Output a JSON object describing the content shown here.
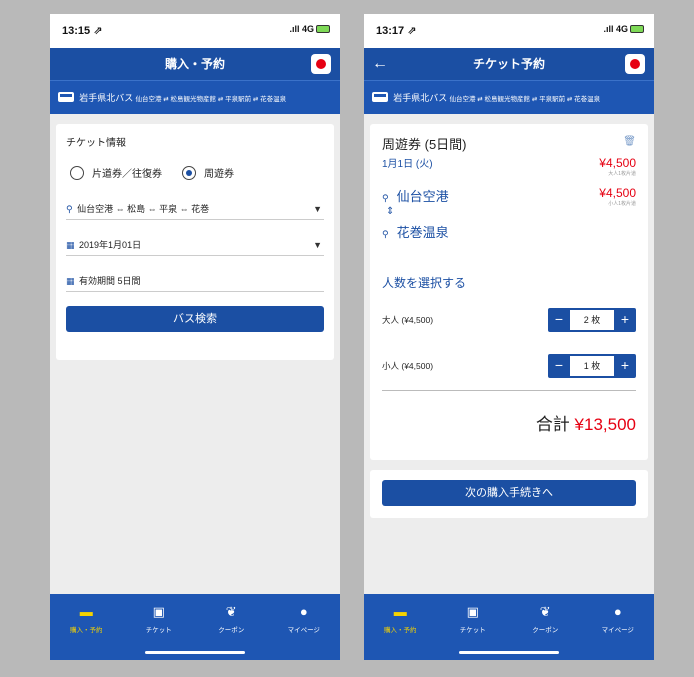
{
  "left": {
    "status_time": "13:15 ⇗",
    "status_signal": ".ıll 4G",
    "nav_title": "購入・予約",
    "route_label": "岩手県北バス",
    "route_stops": "仙台空港 ⇄ 松島観光物産館 ⇄ 平泉駅前 ⇄ 花巻温泉",
    "section_title": "チケット情報",
    "radio_oneway": "片道券／往復券",
    "radio_pass": "周遊券",
    "route_select": "仙台空港 ⇔ 松島 ⇔ 平泉 ⇔ 花巻",
    "date_select": "2019年1月01日",
    "validity": "有効期間 5日間",
    "search_button": "バス検索"
  },
  "right": {
    "status_time": "13:17 ⇗",
    "status_signal": ".ıll 4G",
    "nav_title": "チケット予約",
    "route_label": "岩手県北バス",
    "route_stops": "仙台空港 ⇄ 松島観光物産館 ⇄ 平泉駅前 ⇄ 花巻温泉",
    "ticket_title": "周遊券 (5日間)",
    "ticket_date": "1月1日 (火)",
    "price_adult": "¥4,500",
    "price_adult_note": "大人1枚片道",
    "price_child": "¥4,500",
    "price_child_note": "小人1枚片道",
    "stop_from": "仙台空港",
    "stop_to": "花巻温泉",
    "count_title": "人数を選択する",
    "adult_label": "大人 (¥4,500)",
    "adult_count": "2 枚",
    "child_label": "小人 (¥4,500)",
    "child_count": "1 枚",
    "total_label": "合計",
    "total_amount": "¥13,500",
    "next_button": "次の購入手続きへ"
  },
  "tabs": [
    {
      "label": "購入・予約",
      "icon": "ticket-check-icon"
    },
    {
      "label": "チケット",
      "icon": "ticket-icon"
    },
    {
      "label": "クーポン",
      "icon": "coupon-icon"
    },
    {
      "label": "マイページ",
      "icon": "person-icon"
    }
  ],
  "colors": {
    "brand": "#1b4fa3",
    "accent_red": "#e60012",
    "active_tab": "#f5d300"
  }
}
